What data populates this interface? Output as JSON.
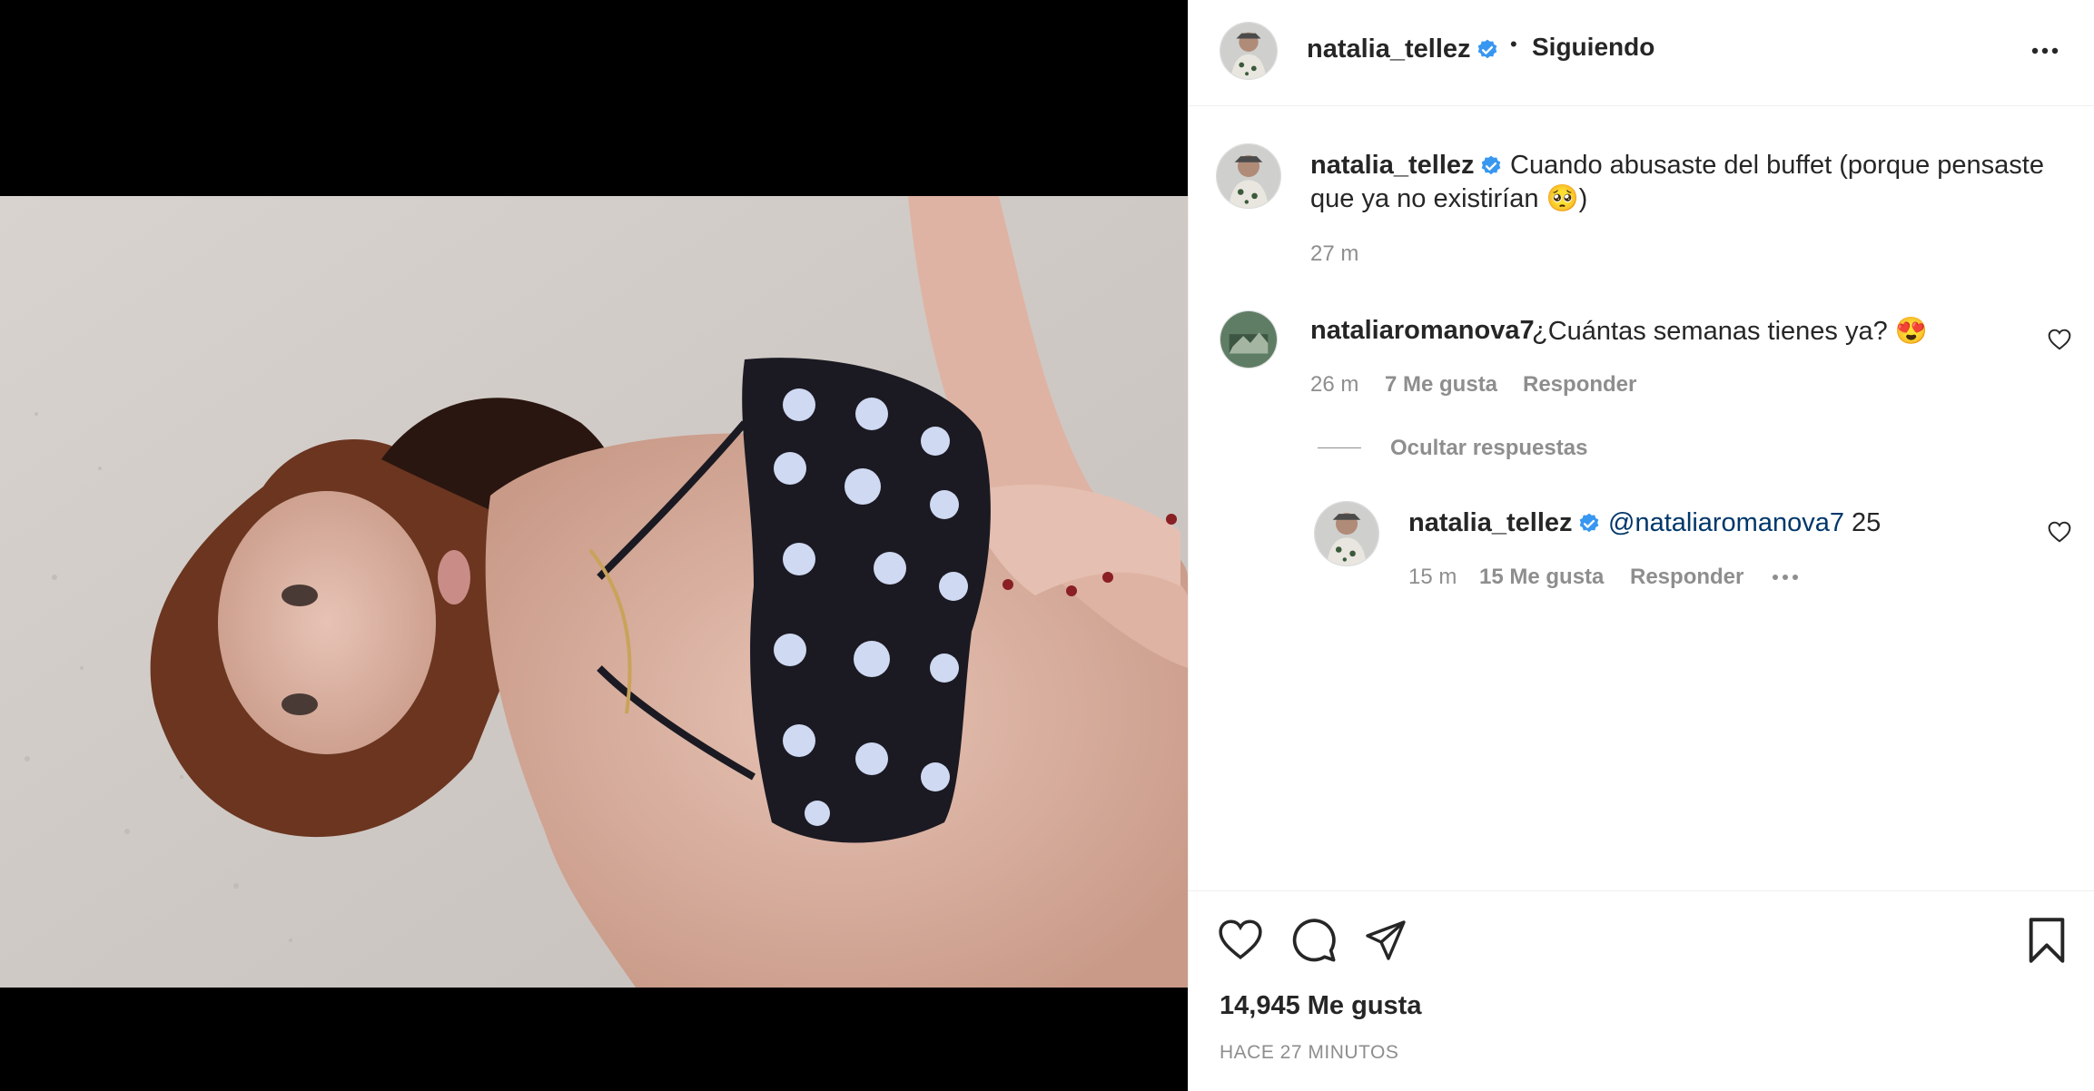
{
  "post": {
    "username": "natalia_tellez",
    "follow_status": "Siguiendo",
    "separator": "•"
  },
  "caption": {
    "username": "natalia_tellez",
    "text": "Cuando abusaste del buffet (porque pensaste",
    "text_line2": "que ya no existirían 🥺)",
    "time": "27 m"
  },
  "comments": [
    {
      "username": "nataliaromanova7",
      "text": "¿Cuántas semanas tienes ya? 😍",
      "time": "26 m",
      "likes": "7 Me gusta",
      "reply_label": "Responder"
    }
  ],
  "replies_toggle": "Ocultar respuestas",
  "reply": {
    "username": "natalia_tellez",
    "mention": "@nataliaromanova7",
    "text": " 25",
    "time": "15 m",
    "likes": "15 Me gusta",
    "reply_label": "Responder"
  },
  "footer": {
    "likes": "14,945 Me gusta",
    "timestamp": "HACE 27 MINUTOS"
  },
  "colors": {
    "verified": "#3897f0",
    "mention": "#00376b",
    "secondary_text": "#8e8e8e"
  },
  "icons": [
    "more-options-icon",
    "heart-icon",
    "comment-icon",
    "share-icon",
    "bookmark-icon",
    "verified-icon",
    "small-heart-icon"
  ]
}
